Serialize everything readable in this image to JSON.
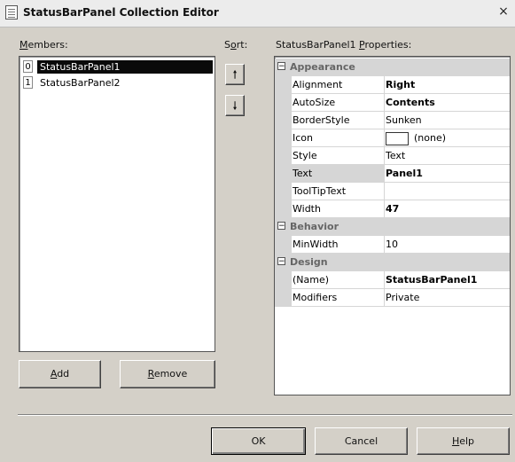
{
  "window": {
    "title": "StatusBarPanel Collection Editor",
    "close_label": "×"
  },
  "members": {
    "label_prefix": "",
    "label_hot": "M",
    "label_rest": "embers:",
    "items": [
      {
        "index": "0",
        "name": "StatusBarPanel1",
        "selected": true
      },
      {
        "index": "1",
        "name": "StatusBarPanel2",
        "selected": false
      }
    ]
  },
  "sort": {
    "label_hot": "S",
    "label_mid": "o",
    "label_hot2": "r",
    "label_rest": "t:",
    "up_glyph": "🠑",
    "down_glyph": "🠓"
  },
  "properties": {
    "label_prefix": "StatusBarPanel1 ",
    "label_hot": "P",
    "label_rest": "roperties:",
    "categories": [
      {
        "name": "Appearance",
        "toggle": "⊟",
        "props": [
          {
            "name": "Alignment",
            "value": "Right",
            "bold": true
          },
          {
            "name": "AutoSize",
            "value": "Contents",
            "bold": true
          },
          {
            "name": "BorderStyle",
            "value": "Sunken",
            "bold": false
          },
          {
            "name": "Icon",
            "value": "(none)",
            "bold": false
          },
          {
            "name": "Style",
            "value": "Text",
            "bold": false
          },
          {
            "name": "Text",
            "value": "Panel1",
            "bold": true
          },
          {
            "name": "ToolTipText",
            "value": "",
            "bold": false
          },
          {
            "name": "Width",
            "value": "47",
            "bold": true
          }
        ]
      },
      {
        "name": "Behavior",
        "toggle": "⊟",
        "props": [
          {
            "name": "MinWidth",
            "value": "10",
            "bold": false
          }
        ]
      },
      {
        "name": "Design",
        "toggle": "⊟",
        "props": [
          {
            "name": "(Name)",
            "value": "StatusBarPanel1",
            "bold": true
          },
          {
            "name": "Modifiers",
            "value": "Private",
            "bold": false
          }
        ]
      }
    ]
  },
  "buttons": {
    "add_hot": "A",
    "add_rest": "dd",
    "remove_hot": "R",
    "remove_rest": "emove",
    "ok": "OK",
    "cancel": "Cancel",
    "help_hot": "H",
    "help_rest": "elp"
  }
}
